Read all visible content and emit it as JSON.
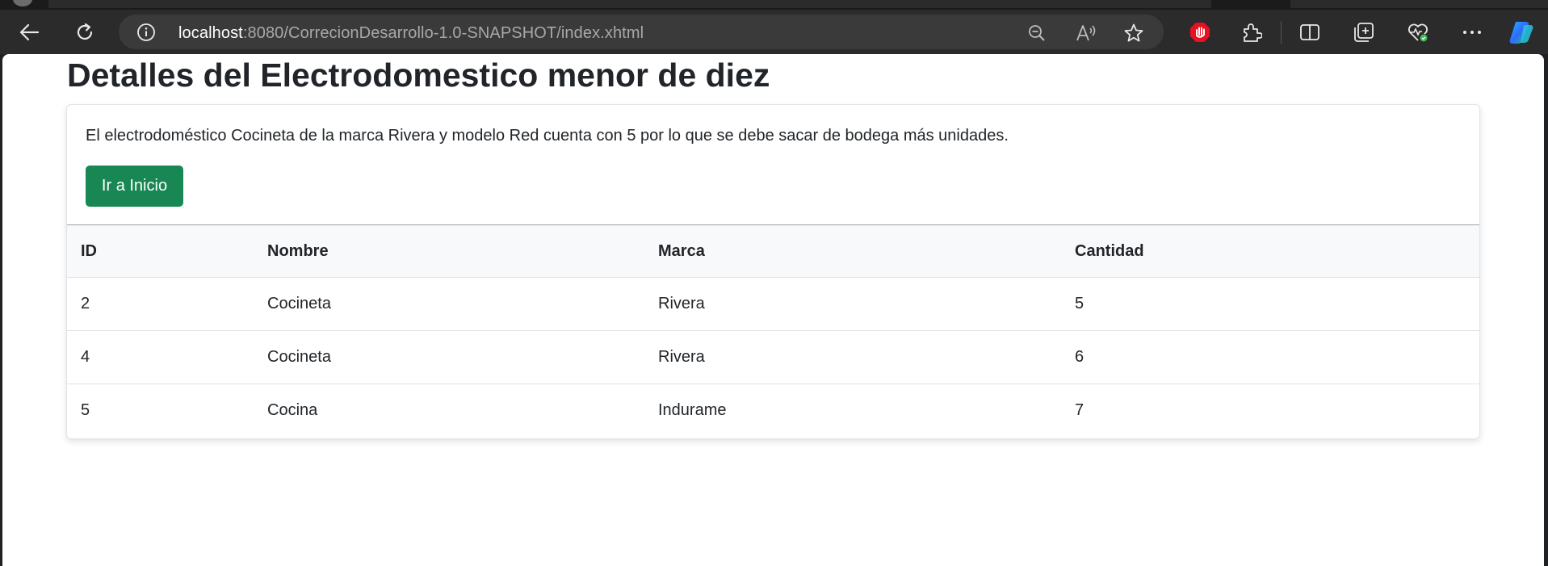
{
  "browser": {
    "url_host": "localhost",
    "url_path": ":8080/CorrecionDesarrollo-1.0-SNAPSHOT/index.xhtml",
    "icons": [
      "back-icon",
      "refresh-icon",
      "site-info-icon",
      "zoom-out-icon",
      "read-aloud-icon",
      "favorite-star-icon",
      "adblock-icon",
      "extensions-icon",
      "split-screen-icon",
      "collections-icon",
      "browser-essentials-icon",
      "more-options-icon",
      "copilot-icon"
    ]
  },
  "page": {
    "title": "Detalles del Electrodomestico menor de diez",
    "message": "El electrodoméstico Cocineta de la marca Rivera y modelo Red cuenta con 5 por lo que se debe sacar de bodega más unidades.",
    "home_button": "Ir a Inicio"
  },
  "table": {
    "headers": [
      "ID",
      "Nombre",
      "Marca",
      "Cantidad"
    ],
    "rows": [
      [
        "2",
        "Cocineta",
        "Rivera",
        "5"
      ],
      [
        "4",
        "Cocineta",
        "Rivera",
        "6"
      ],
      [
        "5",
        "Cocina",
        "Indurame",
        "7"
      ]
    ]
  },
  "colors": {
    "button_green": "#198754",
    "toolbar": "#2b2b2b",
    "address_bar": "#3a3a3a",
    "adblock_red": "#e81123"
  }
}
